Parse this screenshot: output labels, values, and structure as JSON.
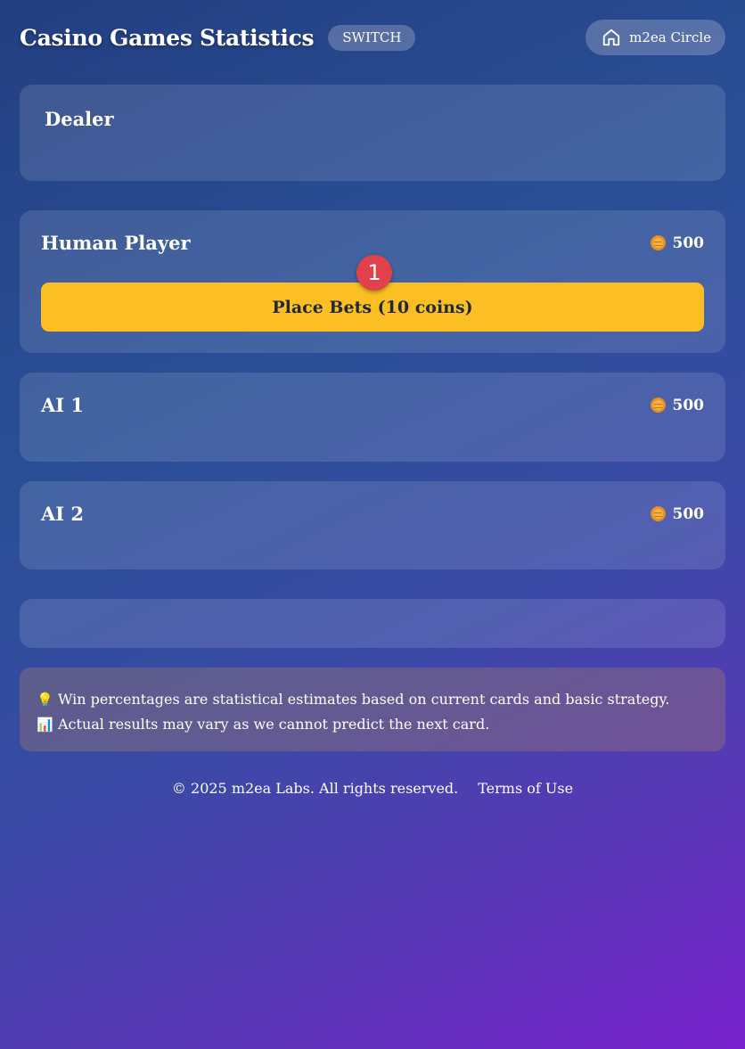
{
  "header": {
    "title": "Casino Games Statistics",
    "switch_label": "SWITCH",
    "circle_label": "m2ea Circle",
    "circle_icon": "home-icon"
  },
  "dealer": {
    "title": "Dealer"
  },
  "players": {
    "human": {
      "name": "Human Player",
      "coins": "500",
      "bet_label": "Place Bets (10 coins)",
      "badge": "1"
    },
    "ai1": {
      "name": "AI 1",
      "coins": "500"
    },
    "ai2": {
      "name": "AI 2",
      "coins": "500"
    }
  },
  "info": {
    "line1_icon": "💡",
    "line1": "Win percentages are statistical estimates based on current cards and basic strategy.",
    "line2_icon": "📊",
    "line2": "Actual results may vary as we cannot predict the next card."
  },
  "footer": {
    "copyright": "© 2025 m2ea Labs. All rights reserved.",
    "terms": "Terms of Use"
  },
  "colors": {
    "accent_button": "#fbbf24",
    "badge": "#e0414a",
    "coin": "#f4b342"
  }
}
